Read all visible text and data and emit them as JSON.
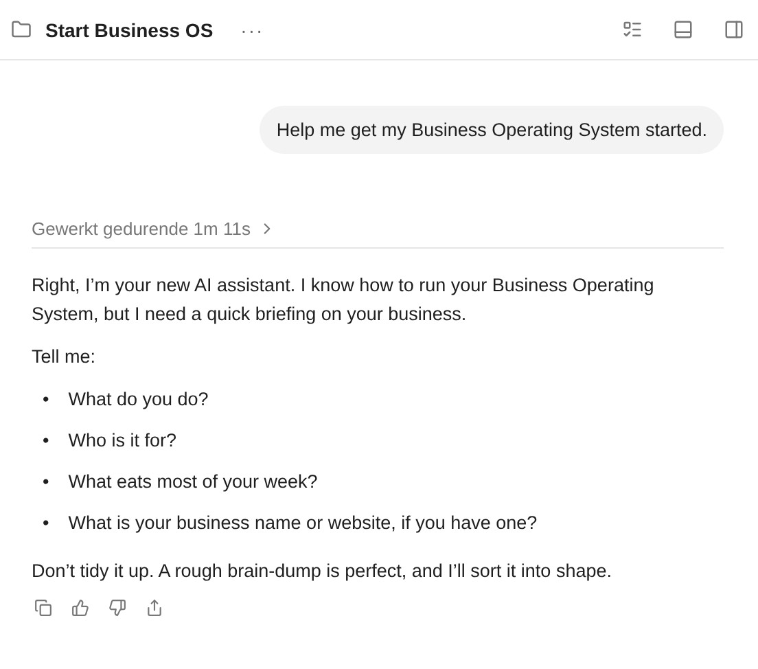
{
  "header": {
    "title": "Start Business OS",
    "more": "···"
  },
  "user_message": "Help me get my Business Operating System started.",
  "worked": {
    "label": "Gewerkt gedurende 1m 11s",
    "expanded": false
  },
  "reply": {
    "intro": "Right, I’m your new AI assistant. I know how to run your Business Operating System, but I need a quick briefing on your business.",
    "prompt": "Tell me:",
    "bullets": [
      {
        "marker": "•",
        "text": "What do you do?"
      },
      {
        "marker": "•",
        "text": "Who is it for?"
      },
      {
        "marker": "•",
        "text": "What eats most of your week?"
      },
      {
        "marker": "•",
        "text": "What is your business name or website, if you have one?"
      }
    ],
    "outro": "Don’t tidy it up. A rough brain-dump is perfect, and I’ll sort it into shape."
  }
}
